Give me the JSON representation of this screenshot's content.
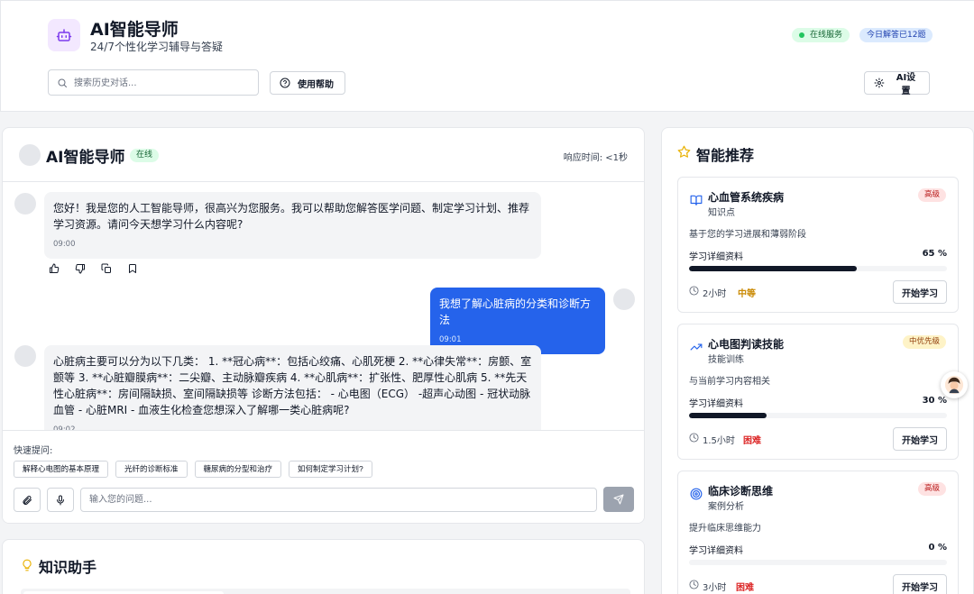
{
  "header": {
    "title": "AI智能导师",
    "subtitle": "24/7个性化学习辅导与答疑",
    "status_online": "在线服务",
    "status_count": "今日解答已12题",
    "search_placeholder": "搜索历史对话...",
    "help_label": "使用帮助",
    "settings_label": "AI设置"
  },
  "chat": {
    "title": "AI智能导师",
    "status": "在线",
    "response_time": "响应时间: <1秒",
    "messages": [
      {
        "role": "ai",
        "text": "您好！我是您的人工智能导师，很高兴为您服务。我可以帮助您解答医学问题、制定学习计划、推荐学习资源。请问今天想学习什么内容呢?",
        "time": "09:00"
      },
      {
        "role": "user",
        "text": "我想了解心脏病的分类和诊断方法",
        "time": "09:01"
      },
      {
        "role": "ai",
        "text": "心脏病主要可以分为以下几类： 1. **冠心病**：包括心绞痛、心肌死梗 2. **心律失常**：房颤、室颤等 3. **心脏瓣膜病**：二尖瓣、主动脉瓣疾病 4. **心肌病**：扩张性、肥厚性心肌病 5. **先天性心脏病**：房间隔缺损、室间隔缺损等 诊断方法包括： - 心电图（ECG） -超声心动图 - 冠状动脉血管 - 心脏MRI - 血液生化检查您想深入了解哪一类心脏病呢?",
        "time": "09:02"
      }
    ],
    "quick_label": "快速提问:",
    "quick_questions": [
      "解释心电图的基本原理",
      "光纤的诊断标准",
      "糖尿病的分型和治疗",
      "如何制定学习计划?"
    ],
    "input_placeholder": "输入您的问题..."
  },
  "knowledge": {
    "title": "知识助手"
  },
  "recommend": {
    "title": "智能推荐",
    "cards": [
      {
        "title": "心血管系统疾病",
        "type": "知识点",
        "priority": "高级",
        "desc": "基于您的学习进展和薄弱阶段",
        "label": "学习详细资料",
        "percent_text": "65 %",
        "progress": 0.65,
        "time": "2小时",
        "difficulty": "中等",
        "button": "开始学习",
        "icon": "book-icon"
      },
      {
        "title": "心电图判读技能",
        "type": "技能训练",
        "priority": "中优先级",
        "desc": "与当前学习内容相关",
        "label": "学习详细资料",
        "percent_text": "30 %",
        "progress": 0.3,
        "time": "1.5小时",
        "difficulty": "困难",
        "button": "开始学习",
        "icon": "trending-up-icon"
      },
      {
        "title": "临床诊断思维",
        "type": "案例分析",
        "priority": "高级",
        "desc": "提升临床思维能力",
        "label": "学习详细资料",
        "percent_text": "0 %",
        "progress": 0,
        "time": "3小时",
        "difficulty": "困难",
        "button": "开始学习",
        "icon": "target-icon"
      }
    ]
  }
}
